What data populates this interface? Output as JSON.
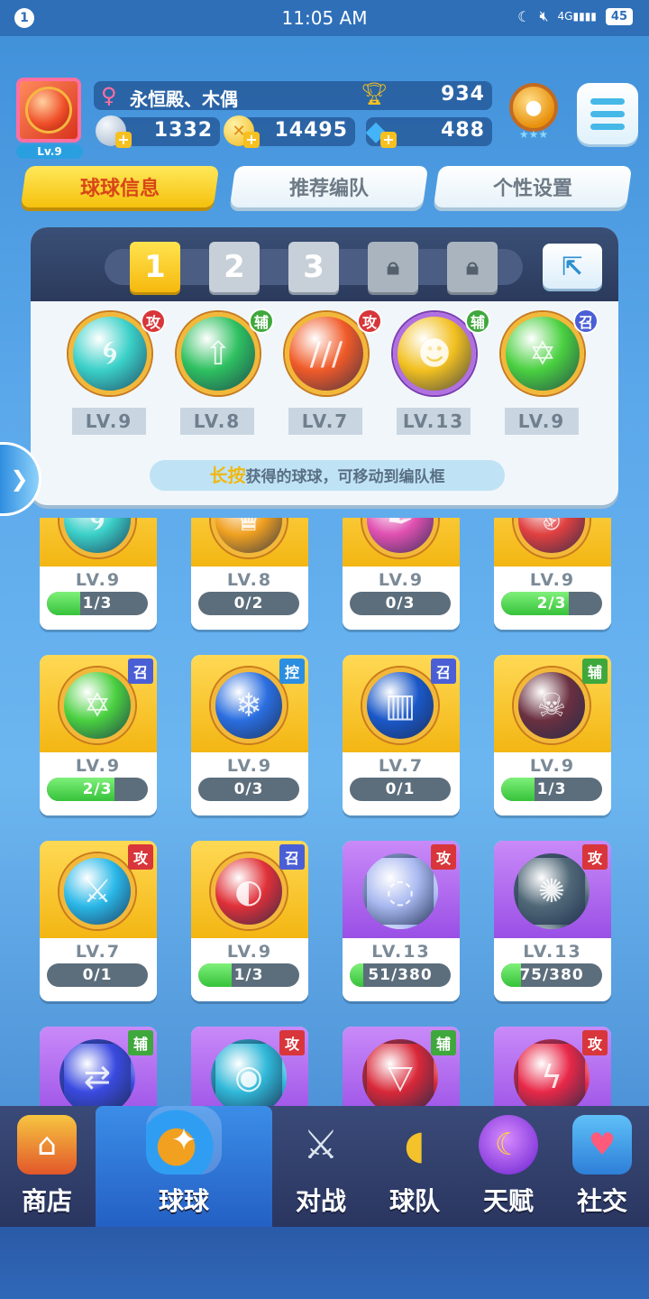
{
  "status_bar": {
    "notif_count": "1",
    "time": "11:05 AM",
    "icons": [
      "moon-icon",
      "mute-icon",
      "signal-4g-icon"
    ],
    "network": "4G",
    "battery": "45"
  },
  "player": {
    "level": "Lv.9",
    "name": "永恒殿、木偶",
    "trophies": "934",
    "currencies": [
      {
        "name": "silver-coin",
        "value": "1332",
        "color": "#b8c8dc"
      },
      {
        "name": "gold-coin",
        "value": "14495",
        "color": "#f5c022"
      },
      {
        "name": "gem",
        "value": "488",
        "color": "#3aa6f0"
      }
    ]
  },
  "tabs": [
    {
      "label": "球球信息",
      "active": true
    },
    {
      "label": "推荐编队",
      "active": false
    },
    {
      "label": "个性设置",
      "active": false
    }
  ],
  "team": {
    "slots": [
      {
        "label": "1",
        "state": "active"
      },
      {
        "label": "2",
        "state": "normal"
      },
      {
        "label": "3",
        "state": "normal"
      },
      {
        "label": "🔒",
        "state": "locked"
      },
      {
        "label": "🔒",
        "state": "locked"
      }
    ],
    "balls": [
      {
        "icon": "tornado-icon",
        "tag": "攻",
        "level": "LV.9",
        "color": "#3ad0c8"
      },
      {
        "icon": "star-arrow-icon",
        "tag": "辅",
        "level": "LV.8",
        "color": "#2ec060"
      },
      {
        "icon": "fire-claw-icon",
        "tag": "攻",
        "level": "LV.7",
        "color": "#f05a28"
      },
      {
        "icon": "pumpkin-icon",
        "tag": "辅",
        "level": "LV.13",
        "color": "#f2c020"
      },
      {
        "icon": "star-emblem-icon",
        "tag": "召",
        "level": "LV.9",
        "color": "#4ad040"
      }
    ],
    "hint_highlight": "长按",
    "hint_text": "获得的球球，可移动到编队框"
  },
  "collection": [
    {
      "icon": "tornado-icon",
      "tag": "",
      "level": "LV.9",
      "progress_text": "1/3",
      "progress": 0.33,
      "bg": "gold",
      "color": "#3ad0c8"
    },
    {
      "icon": "crown-icon",
      "tag": "",
      "level": "LV.8",
      "progress_text": "0/2",
      "progress": 0,
      "bg": "gold",
      "color": "#f0a020"
    },
    {
      "icon": "feather-icon",
      "tag": "",
      "level": "LV.9",
      "progress_text": "0/3",
      "progress": 0,
      "bg": "gold",
      "color": "#e050b0"
    },
    {
      "icon": "fist-icon",
      "tag": "",
      "level": "LV.9",
      "progress_text": "2/3",
      "progress": 0.67,
      "bg": "gold",
      "color": "#e04040"
    },
    {
      "icon": "star-emblem-icon",
      "tag": "召",
      "level": "LV.9",
      "progress_text": "2/3",
      "progress": 0.67,
      "bg": "gold",
      "color": "#4ad040"
    },
    {
      "icon": "snowflake-icon",
      "tag": "控",
      "level": "LV.9",
      "progress_text": "0/3",
      "progress": 0,
      "bg": "gold",
      "color": "#2a6ee0"
    },
    {
      "icon": "ice-wall-icon",
      "tag": "召",
      "level": "LV.7",
      "progress_text": "0/1",
      "progress": 0,
      "bg": "gold",
      "color": "#1a58c8"
    },
    {
      "icon": "skull-icon",
      "tag": "辅",
      "level": "LV.9",
      "progress_text": "1/3",
      "progress": 0.33,
      "bg": "gold",
      "color": "#6a3040"
    },
    {
      "icon": "sword-icon",
      "tag": "攻",
      "level": "LV.7",
      "progress_text": "0/1",
      "progress": 0,
      "bg": "gold",
      "color": "#2ab8e8"
    },
    {
      "icon": "cannon-icon",
      "tag": "召",
      "level": "LV.9",
      "progress_text": "1/3",
      "progress": 0.33,
      "bg": "gold",
      "color": "#e03038"
    },
    {
      "icon": "moon-bubble-icon",
      "tag": "攻",
      "level": "LV.13",
      "progress_text": "51/380",
      "progress": 0.134,
      "bg": "purple",
      "color": "#a8b8f0"
    },
    {
      "icon": "vortex-icon",
      "tag": "攻",
      "level": "LV.13",
      "progress_text": "75/380",
      "progress": 0.197,
      "bg": "purple",
      "color": "#506878"
    },
    {
      "icon": "swap-arrows-icon",
      "tag": "辅",
      "level": "",
      "progress_text": "",
      "progress": 0,
      "bg": "purple",
      "color": "#3a4ae0"
    },
    {
      "icon": "swirl-icon",
      "tag": "攻",
      "level": "",
      "progress_text": "",
      "progress": 0,
      "bg": "purple",
      "color": "#30b8d8"
    },
    {
      "icon": "fang-icon",
      "tag": "辅",
      "level": "",
      "progress_text": "",
      "progress": 0,
      "bg": "purple",
      "color": "#d82838"
    },
    {
      "icon": "lightning-icon",
      "tag": "攻",
      "level": "",
      "progress_text": "",
      "progress": 0,
      "bg": "purple",
      "color": "#e82848"
    }
  ],
  "bottom_nav": [
    {
      "label": "商店",
      "icon": "shop-icon",
      "active": false
    },
    {
      "label": "球球",
      "icon": "balls-jar-icon",
      "active": true
    },
    {
      "label": "对战",
      "icon": "crossed-swords-icon",
      "active": false
    },
    {
      "label": "球队",
      "icon": "whistle-icon",
      "active": false
    },
    {
      "label": "天赋",
      "icon": "planet-icon",
      "active": false
    },
    {
      "label": "社交",
      "icon": "chat-heart-icon",
      "active": false
    }
  ]
}
